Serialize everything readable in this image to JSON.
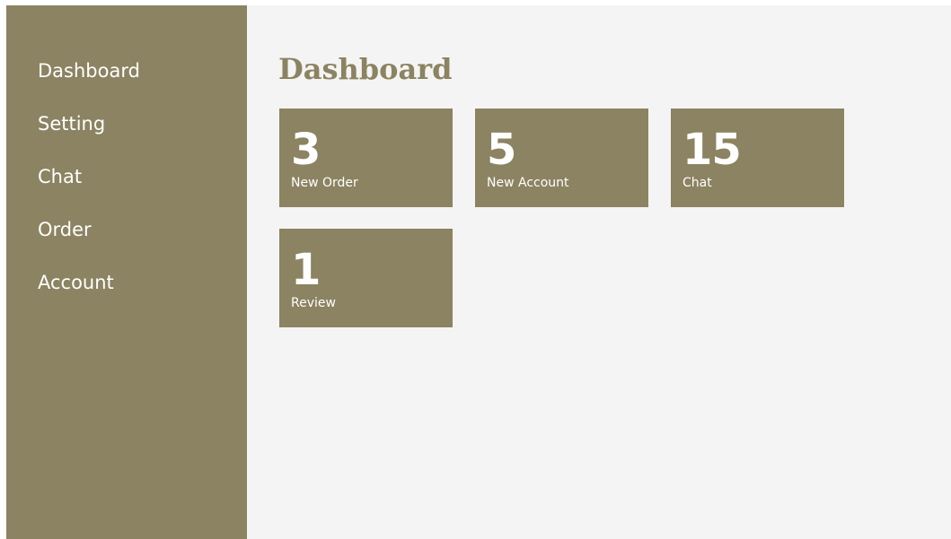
{
  "sidebar": {
    "items": [
      {
        "label": "Dashboard"
      },
      {
        "label": "Setting"
      },
      {
        "label": "Chat"
      },
      {
        "label": "Order"
      },
      {
        "label": "Account"
      }
    ]
  },
  "main": {
    "title": "Dashboard",
    "cards": [
      {
        "value": "3",
        "label": "New Order"
      },
      {
        "value": "5",
        "label": "New Account"
      },
      {
        "value": "15",
        "label": "Chat"
      },
      {
        "value": "1",
        "label": "Review"
      }
    ]
  },
  "colors": {
    "accent": "#8b8361",
    "background": "#f4f4f4",
    "text_on_accent": "#ffffff"
  }
}
